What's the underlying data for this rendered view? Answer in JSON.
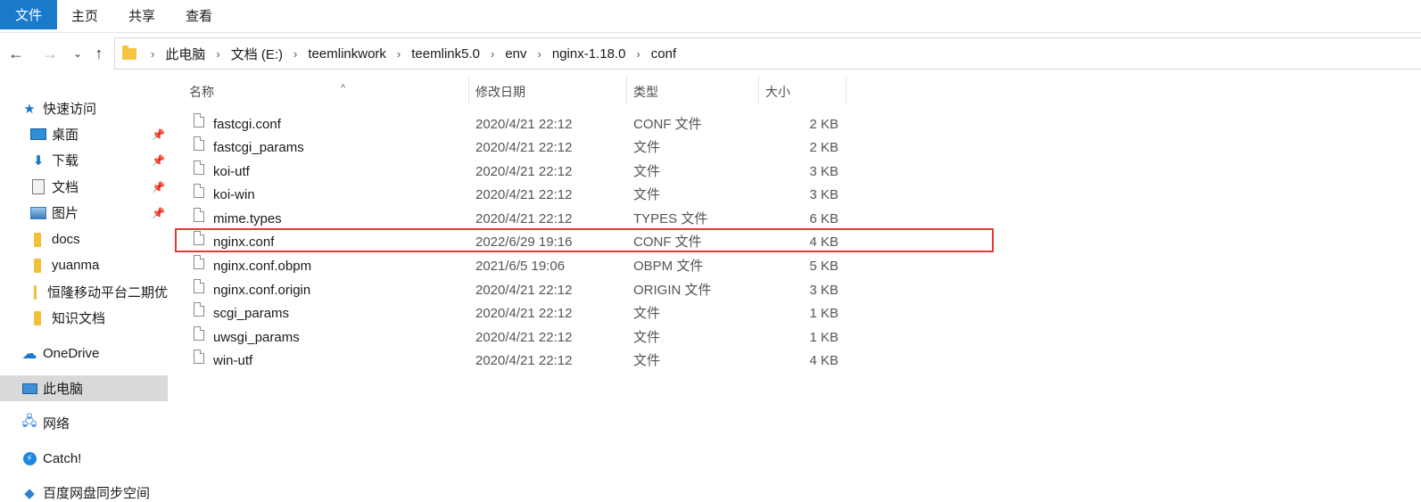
{
  "ribbon": {
    "tabs": [
      "文件",
      "主页",
      "共享",
      "查看"
    ]
  },
  "address": {
    "crumbs": [
      "此电脑",
      "文档 (E:)",
      "teemlinkwork",
      "teemlink5.0",
      "env",
      "nginx-1.18.0",
      "conf"
    ],
    "separator": "›"
  },
  "sidebar": {
    "items": [
      {
        "label": "快速访问",
        "icon": "star-icon"
      },
      {
        "label": "桌面",
        "icon": "desktop-icon",
        "pinned": true
      },
      {
        "label": "下载",
        "icon": "download-icon",
        "pinned": true
      },
      {
        "label": "文档",
        "icon": "document-icon",
        "pinned": true
      },
      {
        "label": "图片",
        "icon": "picture-icon",
        "pinned": true
      },
      {
        "label": "docs",
        "icon": "folder-icon"
      },
      {
        "label": "yuanma",
        "icon": "folder-icon"
      },
      {
        "label": "恒隆移动平台二期优",
        "icon": "folder-icon"
      },
      {
        "label": "知识文档",
        "icon": "folder-icon"
      },
      {
        "label": "OneDrive",
        "icon": "cloud-icon"
      },
      {
        "label": "此电脑",
        "icon": "computer-icon",
        "selected": true
      },
      {
        "label": "网络",
        "icon": "network-icon"
      },
      {
        "label": "Catch!",
        "icon": "catch-icon"
      },
      {
        "label": "百度网盘同步空间",
        "icon": "baidu-icon"
      }
    ]
  },
  "columns": {
    "name": "名称",
    "date": "修改日期",
    "type": "类型",
    "size": "大小"
  },
  "files": [
    {
      "name": "fastcgi.conf",
      "date": "2020/4/21 22:12",
      "type": "CONF 文件",
      "size": "2 KB"
    },
    {
      "name": "fastcgi_params",
      "date": "2020/4/21 22:12",
      "type": "文件",
      "size": "2 KB"
    },
    {
      "name": "koi-utf",
      "date": "2020/4/21 22:12",
      "type": "文件",
      "size": "3 KB"
    },
    {
      "name": "koi-win",
      "date": "2020/4/21 22:12",
      "type": "文件",
      "size": "3 KB"
    },
    {
      "name": "mime.types",
      "date": "2020/4/21 22:12",
      "type": "TYPES 文件",
      "size": "6 KB"
    },
    {
      "name": "nginx.conf",
      "date": "2022/6/29 19:16",
      "type": "CONF 文件",
      "size": "4 KB",
      "highlighted": true
    },
    {
      "name": "nginx.conf.obpm",
      "date": "2021/6/5 19:06",
      "type": "OBPM 文件",
      "size": "5 KB"
    },
    {
      "name": "nginx.conf.origin",
      "date": "2020/4/21 22:12",
      "type": "ORIGIN 文件",
      "size": "3 KB"
    },
    {
      "name": "scgi_params",
      "date": "2020/4/21 22:12",
      "type": "文件",
      "size": "1 KB"
    },
    {
      "name": "uwsgi_params",
      "date": "2020/4/21 22:12",
      "type": "文件",
      "size": "1 KB"
    },
    {
      "name": "win-utf",
      "date": "2020/4/21 22:12",
      "type": "文件",
      "size": "4 KB"
    }
  ],
  "colors": {
    "accent": "#1979ca",
    "highlight": "#e53935",
    "selected": "#d9d9d9"
  }
}
